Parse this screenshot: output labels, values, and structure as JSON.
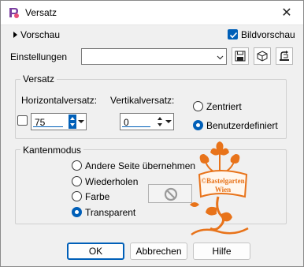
{
  "window": {
    "title": "Versatz",
    "close_glyph": "✕"
  },
  "preview": {
    "toggle_label": "Vorschau",
    "checkbox_label": "Bildvorschau",
    "checked": true
  },
  "presets": {
    "label": "Einstellungen",
    "value": "",
    "icons": [
      "save-preset-icon",
      "preset-options-icon",
      "reset-preset-icon"
    ]
  },
  "offset_group": {
    "title": "Versatz",
    "horizontal_label": "Horizontalversatz:",
    "horizontal_value": "75",
    "vertical_label": "Vertikalversatz:",
    "vertical_value": "0",
    "link_checked": false,
    "radio_centered": "Zentriert",
    "radio_custom": "Benutzerdefiniert",
    "selected": "custom"
  },
  "edge_group": {
    "title": "Kantenmodus",
    "options": [
      "Andere Seite übernehmen",
      "Wiederholen",
      "Farbe",
      "Transparent"
    ],
    "selected": "Transparent",
    "color_icon": "no-color-icon"
  },
  "watermark": {
    "line1": "©Bastelgarten",
    "line2": "Wien",
    "color": "#e8731a"
  },
  "buttons": {
    "ok": "OK",
    "cancel": "Abbrechen",
    "help": "Hilfe"
  },
  "colors": {
    "accent": "#005fb8",
    "dialog_bg": "#f0f0f0"
  }
}
